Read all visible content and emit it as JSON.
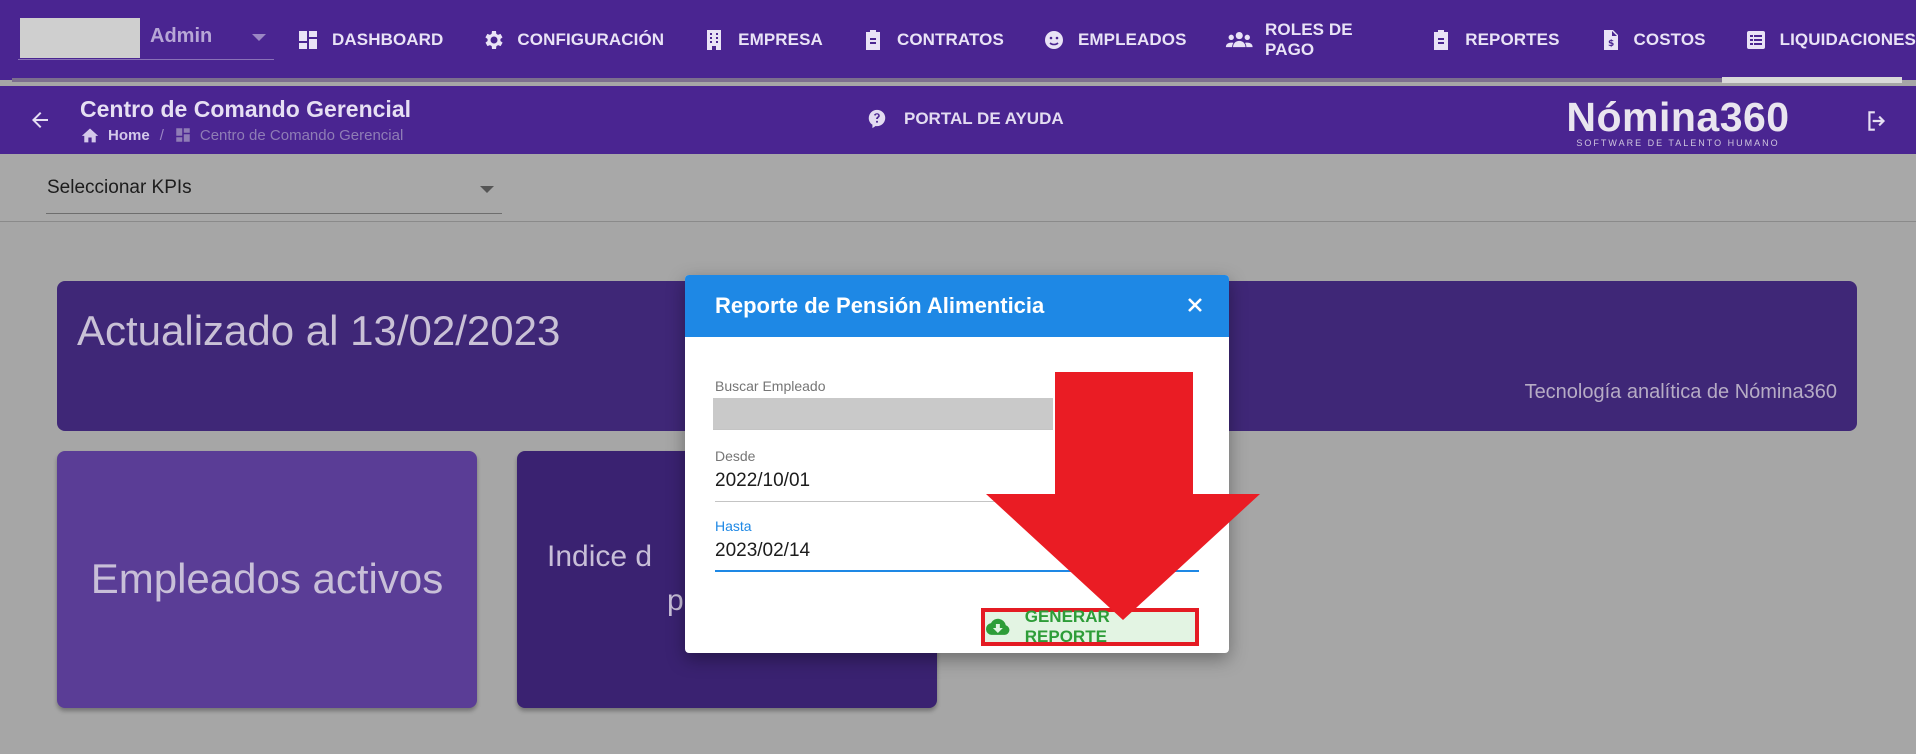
{
  "topnav": {
    "company_name": "Admin",
    "items": [
      {
        "label": "DASHBOARD",
        "icon": "dashboard-icon"
      },
      {
        "label": "CONFIGURACIÓN",
        "icon": "gear-icon"
      },
      {
        "label": "EMPRESA",
        "icon": "building-icon"
      },
      {
        "label": "CONTRATOS",
        "icon": "clipboard-icon"
      },
      {
        "label": "EMPLEADOS",
        "icon": "face-icon"
      },
      {
        "label": "ROLES DE PAGO",
        "icon": "users-icon"
      },
      {
        "label": "REPORTES",
        "icon": "clipboard-list-icon"
      },
      {
        "label": "COSTOS",
        "icon": "invoice-icon"
      },
      {
        "label": "LIQUIDACIONES",
        "icon": "list-icon"
      }
    ]
  },
  "subheader": {
    "title": "Centro de Comando Gerencial",
    "breadcrumb_home": "Home",
    "breadcrumb_current": "Centro de Comando Gerencial",
    "portal": "PORTAL DE AYUDA",
    "logo_text": "Nómina360",
    "logo_sub": "SOFTWARE DE TALENTO HUMANO"
  },
  "kpi": {
    "value": "Seleccionar KPIs"
  },
  "banner": {
    "title": "Actualizado al 13/02/2023",
    "subtitle": "Tecnología analítica de Nómina360"
  },
  "cards": [
    {
      "label": "Empleados activos"
    },
    {
      "label": "Indice d                 p"
    }
  ],
  "modal": {
    "title": "Reporte de Pensión Alimenticia",
    "fields": {
      "employee_label": "Buscar Empleado",
      "from_label": "Desde",
      "from_value": "2022/10/01",
      "to_label": "Hasta",
      "to_value": "2023/02/14"
    },
    "generate_label": "GENERAR REPORTE"
  },
  "colors": {
    "nav": "#4a2591",
    "modal_header": "#1e88e5",
    "generate_text": "#2e9d38",
    "highlight": "#e41b23"
  }
}
